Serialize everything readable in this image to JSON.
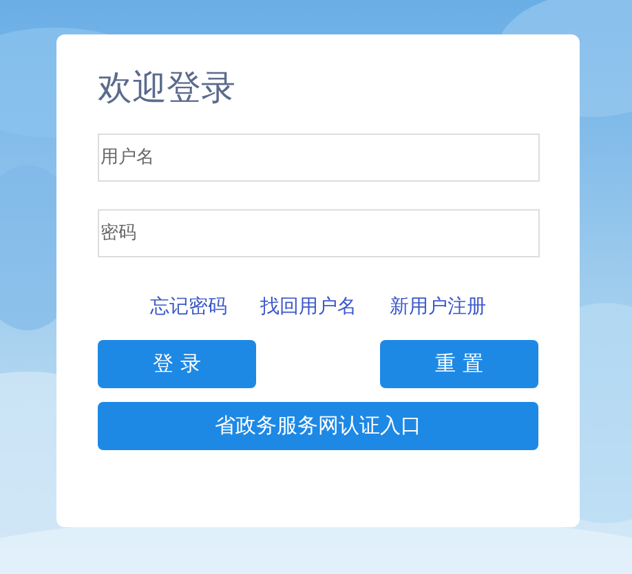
{
  "title": "欢迎登录",
  "fields": [
    {
      "placeholder": "用户名"
    },
    {
      "placeholder": "密码"
    }
  ],
  "links": [
    "忘记密码",
    "找回用户名",
    "新用户注册"
  ],
  "buttons": [
    "登 录",
    "重 置"
  ],
  "wide_button": "省政务服务网认证入口"
}
